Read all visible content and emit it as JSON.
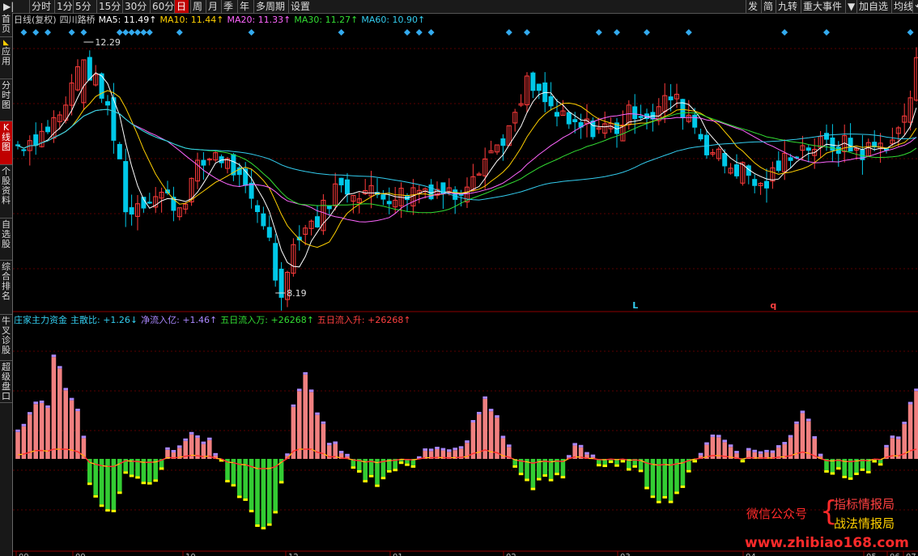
{
  "toolbar": {
    "left": [
      {
        "label": "▶|",
        "active": false
      },
      {
        "label": "分时",
        "active": false
      },
      {
        "label": "1分",
        "active": false
      },
      {
        "label": "5分",
        "active": false
      },
      {
        "label": "15分",
        "active": false
      },
      {
        "label": "30分",
        "active": false
      },
      {
        "label": "60分",
        "active": false
      },
      {
        "label": "日",
        "active": true
      },
      {
        "label": "周",
        "active": false
      },
      {
        "label": "月",
        "active": false
      },
      {
        "label": "季",
        "active": false
      },
      {
        "label": "年",
        "active": false
      },
      {
        "label": "多周期",
        "active": false
      },
      {
        "label": "设置",
        "active": false
      }
    ],
    "right": [
      "发",
      "简",
      "九转",
      "重大事件",
      "▼",
      "加自选",
      "均线",
      "⟲"
    ]
  },
  "sidebar": [
    {
      "label": "首页",
      "active": false,
      "icon": false
    },
    {
      "label": "应用",
      "active": false,
      "icon": true
    },
    {
      "label": "分时图",
      "active": false,
      "icon": false
    },
    {
      "label": "K线图",
      "active": true,
      "icon": false
    },
    {
      "label": "个股资料",
      "active": false,
      "icon": false
    },
    {
      "label": "自选股",
      "active": false,
      "icon": false
    },
    {
      "label": "综合排名",
      "active": false,
      "icon": false
    },
    {
      "label": "牛叉诊股",
      "active": false,
      "icon": false
    },
    {
      "label": "超级盘口",
      "active": false,
      "icon": false
    }
  ],
  "main_info": [
    {
      "text": "日线(复权)",
      "color": "#d0d0d0"
    },
    {
      "text": "四川路桥",
      "color": "#d0d0d0"
    },
    {
      "text": "MA5: 11.49↑",
      "color": "#ffffff"
    },
    {
      "text": "MA10: 11.44↑",
      "color": "#ffd000"
    },
    {
      "text": "MA20: 11.33↑",
      "color": "#ff66ff"
    },
    {
      "text": "MA30: 11.27↑",
      "color": "#33dd33"
    },
    {
      "text": "MA60: 10.90↑",
      "color": "#33ccee"
    }
  ],
  "sub_info": [
    {
      "text": "庄家主力资金",
      "color": "#33ccee"
    },
    {
      "text": "主散比: +1.26↓",
      "color": "#33ccee"
    },
    {
      "text": "净流入亿: +1.46↑",
      "color": "#aa88ff"
    },
    {
      "text": "五日流入万: +26268↑",
      "color": "#33dd33"
    },
    {
      "text": "五日流入升: +26268↑",
      "color": "#ff4040"
    }
  ],
  "price_labels": {
    "high": "12.29",
    "low": "8.19"
  },
  "signals": [
    {
      "label": "L",
      "color": "#33ccee",
      "index": 103
    },
    {
      "label": "q",
      "color": "#ff4040",
      "index": 126
    }
  ],
  "axis_dates": [
    "09",
    "09",
    "10",
    "12",
    "01",
    "02",
    "03",
    "04",
    "05",
    "06",
    "07"
  ],
  "chart_data": {
    "type": "candlestick",
    "high": 12.29,
    "low": 8.19,
    "ma_series": [
      "MA5",
      "MA10",
      "MA20",
      "MA30",
      "MA60"
    ],
    "ma_values": [
      11.49,
      11.44,
      11.33,
      11.27,
      10.9
    ]
  },
  "colors": {
    "up": "#ff3b3b",
    "down": "#00c8e8",
    "bar_up": "#f08080",
    "bar_down": "#33cc33"
  },
  "watermark": {
    "left": "微信公众号",
    "brace": "{",
    "right1": "指标情报局",
    "right2": "战法情报局",
    "url": "www.zhibiao168.com"
  }
}
